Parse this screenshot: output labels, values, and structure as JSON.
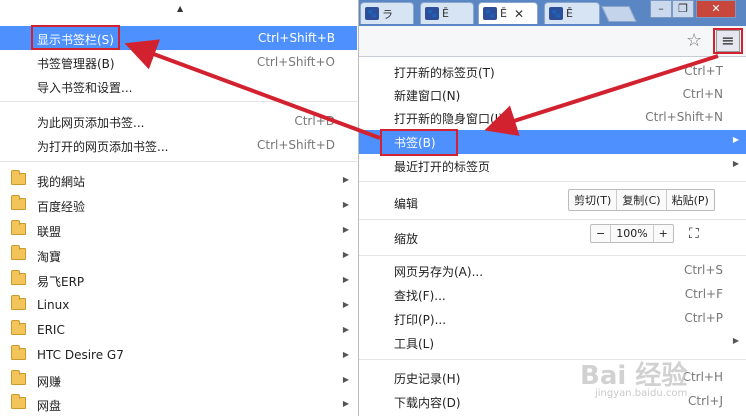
{
  "tabs": [
    {
      "label": "ラ",
      "active": false
    },
    {
      "label": "Ē",
      "active": false
    },
    {
      "label": "Ē",
      "active": true
    },
    {
      "label": "Ē",
      "active": false
    }
  ],
  "window": {
    "minimize": "–",
    "maximize": "❐",
    "close": "✕"
  },
  "toolbar": {
    "star": "☆",
    "menu": "≡"
  },
  "bookmark_submenu": {
    "items": [
      {
        "label": "显示书签栏(S)",
        "shortcut": "Ctrl+Shift+B",
        "highlighted": true
      },
      {
        "label": "书签管理器(B)",
        "shortcut": "Ctrl+Shift+O"
      },
      {
        "label": "导入书签和设置...",
        "shortcut": ""
      },
      {
        "label": "为此网页添加书签...",
        "shortcut": "Ctrl+D"
      },
      {
        "label": "为打开的网页添加书签...",
        "shortcut": "Ctrl+Shift+D"
      }
    ],
    "folders": [
      "我的網站",
      "百度经验",
      "联盟",
      "淘寶",
      "易飞ERP",
      "Linux",
      "ERIC",
      "HTC Desire G7",
      "网赚",
      "网盘"
    ]
  },
  "main_menu": {
    "group1": [
      {
        "label": "打开新的标签页(T)",
        "shortcut": "Ctrl+T"
      },
      {
        "label": "新建窗口(N)",
        "shortcut": "Ctrl+N"
      },
      {
        "label": "打开新的隐身窗口(I)",
        "shortcut": "Ctrl+Shift+N"
      }
    ],
    "bookmarks": {
      "label": "书签(B)"
    },
    "recent": {
      "label": "最近打开的标签页"
    },
    "edit": {
      "label": "编辑",
      "cut": "剪切(T)",
      "copy": "复制(C)",
      "paste": "粘贴(P)"
    },
    "zoom": {
      "label": "缩放",
      "minus": "−",
      "value": "100%",
      "plus": "+",
      "fullscreen": "⛶"
    },
    "group2": [
      {
        "label": "网页另存为(A)...",
        "shortcut": "Ctrl+S"
      },
      {
        "label": "查找(F)...",
        "shortcut": "Ctrl+F"
      },
      {
        "label": "打印(P)...",
        "shortcut": "Ctrl+P"
      }
    ],
    "tools": {
      "label": "工具(L)"
    },
    "group3": [
      {
        "label": "历史记录(H)",
        "shortcut": "Ctrl+H"
      },
      {
        "label": "下载内容(D)",
        "shortcut": "Ctrl+J"
      }
    ]
  },
  "watermark": {
    "logo": "Bai 经验",
    "url": "jingyan.baidu.com"
  },
  "colors": {
    "highlight": "#4d90fe",
    "annotation": "#d3222f"
  }
}
